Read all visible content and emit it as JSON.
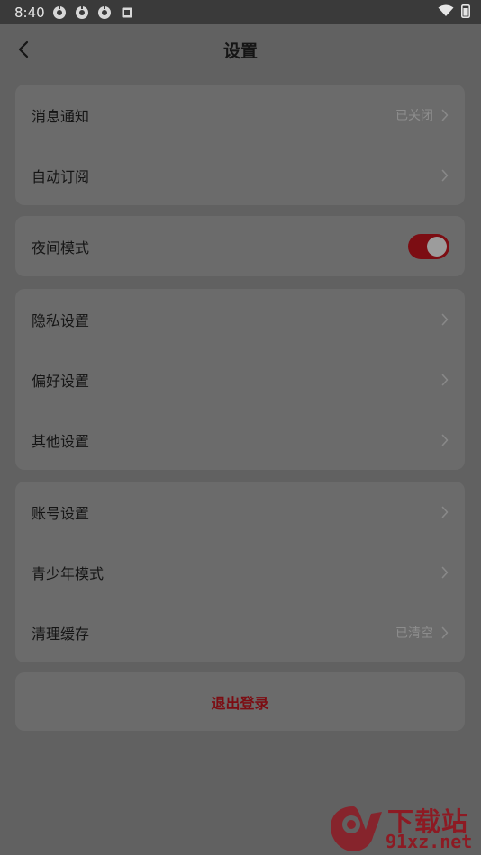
{
  "status_bar": {
    "time": "8:40",
    "icons": [
      "app-icon",
      "app-icon",
      "app-icon",
      "notification-icon",
      "wifi-icon",
      "battery-icon"
    ]
  },
  "header": {
    "title": "设置",
    "back_icon": "chevron-left-icon"
  },
  "groups": [
    {
      "items": [
        {
          "label": "消息通知",
          "value": "已关闭"
        },
        {
          "label": "自动订阅"
        }
      ]
    },
    {
      "items": [
        {
          "label": "夜间模式",
          "toggle": true
        }
      ]
    },
    {
      "items": [
        {
          "label": "隐私设置"
        },
        {
          "label": "偏好设置"
        },
        {
          "label": "其他设置"
        }
      ]
    },
    {
      "items": [
        {
          "label": "账号设置"
        },
        {
          "label": "青少年模式"
        },
        {
          "label": "清理缓存",
          "value": "已清空"
        }
      ]
    }
  ],
  "logout": {
    "label": "退出登录"
  },
  "watermark": {
    "line1": "下载站",
    "line2": "91xz.net",
    "logo_text": "91"
  },
  "colors": {
    "accent": "#7c0d13",
    "background": "#616161",
    "card": "#6b6b6b"
  }
}
